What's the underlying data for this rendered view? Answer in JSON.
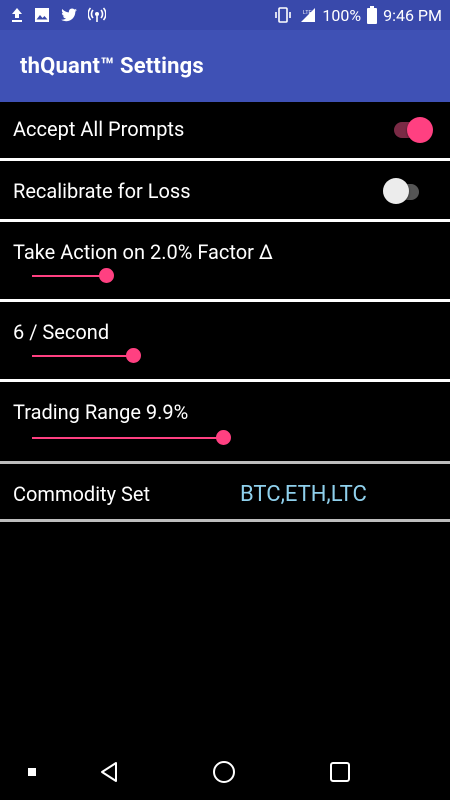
{
  "status_bar": {
    "left_icons": [
      "upload-icon",
      "image-icon",
      "twitter-icon",
      "hotspot-icon"
    ],
    "right_icons": [
      "vibrate-icon",
      "signal-lte-icon",
      "battery-icon"
    ],
    "battery": "100%",
    "time": "9:46 PM"
  },
  "app_bar": {
    "title": "thQuant™ Settings"
  },
  "settings": {
    "accept_all_prompts": {
      "label": "Accept All Prompts",
      "enabled": true
    },
    "recalibrate_for_loss": {
      "label": "Recalibrate for Loss",
      "enabled": false
    },
    "action_factor": {
      "label": "Take Action on 2.0% Factor Δ",
      "level": 0.19
    },
    "rate": {
      "label": "6 / Second",
      "level": 0.26
    },
    "trading_range": {
      "label": "Trading Range 9.9%",
      "level": 0.49
    },
    "commodity_set": {
      "label": "Commodity Set",
      "value": "BTC,ETH,LTC"
    }
  },
  "nav_bar": {
    "buttons": [
      "recents-dot-icon",
      "back-icon",
      "home-icon",
      "overview-icon"
    ]
  },
  "colors": {
    "status_bar": "#3949ab",
    "app_bar": "#3f51b5",
    "accent": "#ff4081",
    "value_text": "#8fd0ec",
    "background": "#000000"
  }
}
